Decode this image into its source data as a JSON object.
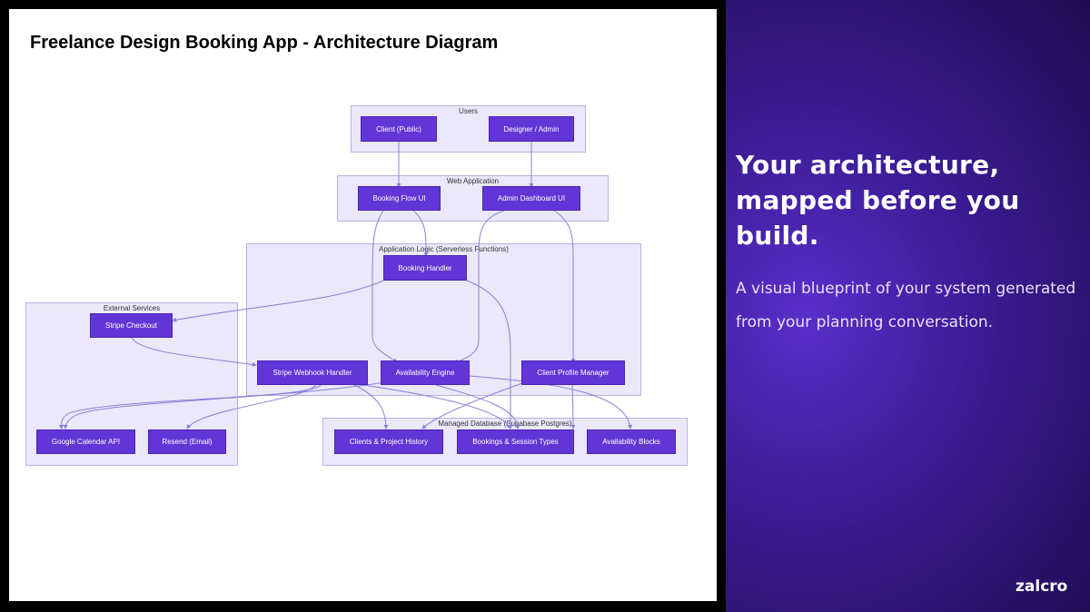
{
  "diagram": {
    "title": "Freelance Design Booking App -  Architecture Diagram",
    "groups": {
      "users": "Users",
      "web_application": "Web Application",
      "application_logic": "Application Logic (Serverless Functions)",
      "external_services": "External Services",
      "managed_database": "Managed Database (Supabase Postgres)"
    },
    "nodes": {
      "client_public": "Client (Public)",
      "designer_admin": "Designer / Admin",
      "booking_flow_ui": "Booking Flow UI",
      "admin_dashboard_ui": "Admin Dashboard UI",
      "booking_handler": "Booking Handler",
      "stripe_checkout": "Stripe Checkout",
      "stripe_webhook_handler": "Stripe Webhook Handler",
      "availability_engine": "Availability Engine",
      "client_profile_manager": "Client Profile Manager",
      "google_calendar_api": "Google Calendar API",
      "resend_email": "Resend (Email)",
      "clients_project_history": "Clients & Project History",
      "bookings_session_types": "Bookings & Session Types",
      "availability_blocks": "Availability Blocks"
    },
    "colors": {
      "node_fill": "#6236d6",
      "group_fill": "#ebe8fb",
      "edge": "#8a80d9"
    }
  },
  "panel": {
    "headline": "Your architecture, mapped before you build.",
    "subtext": "A visual blueprint of your system generated from your planning conversation.",
    "logo": "zalcro"
  }
}
